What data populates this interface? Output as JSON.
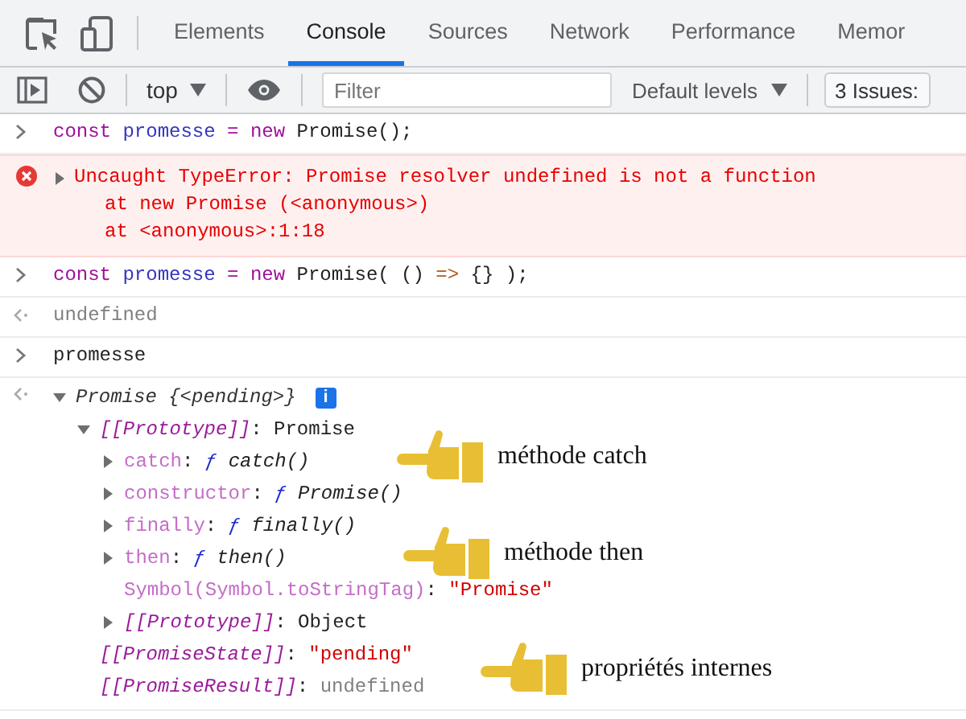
{
  "tabbar": {
    "tabs": [
      {
        "label": "Elements",
        "selected": false
      },
      {
        "label": "Console",
        "selected": true
      },
      {
        "label": "Sources",
        "selected": false
      },
      {
        "label": "Network",
        "selected": false
      },
      {
        "label": "Performance",
        "selected": false
      },
      {
        "label": "Memor",
        "selected": false
      }
    ]
  },
  "toolbar": {
    "context": "top",
    "filter": {
      "placeholder": "Filter"
    },
    "levels": "Default levels",
    "issues": "3 Issues:"
  },
  "entries": [
    {
      "kind": "input",
      "tokens": [
        {
          "text": "const ",
          "kind": "keyword"
        },
        {
          "text": "promesse",
          "kind": "variable"
        },
        {
          "text": " = ",
          "kind": "keyword"
        },
        {
          "text": "new ",
          "kind": "keyword"
        },
        {
          "text": "Promise();",
          "kind": "plain"
        }
      ]
    },
    {
      "kind": "error",
      "expanded": false,
      "message": "Uncaught TypeError: Promise resolver undefined is not a function",
      "stack": [
        "at new Promise (<anonymous>)",
        "at <anonymous>:1:18"
      ]
    },
    {
      "kind": "input",
      "tokens": [
        {
          "text": "const ",
          "kind": "keyword"
        },
        {
          "text": "promesse",
          "kind": "variable"
        },
        {
          "text": " = ",
          "kind": "keyword"
        },
        {
          "text": "new ",
          "kind": "keyword"
        },
        {
          "text": "Promise( () ",
          "kind": "plain"
        },
        {
          "text": "=>",
          "kind": "arrow"
        },
        {
          "text": " {} );",
          "kind": "plain"
        }
      ]
    },
    {
      "kind": "result",
      "tokens": [
        {
          "text": "undefined",
          "kind": "undef"
        }
      ]
    },
    {
      "kind": "input",
      "tokens": [
        {
          "text": "promesse",
          "kind": "plain"
        }
      ]
    },
    {
      "kind": "tree",
      "badge": "i",
      "root": {
        "kind": "node",
        "expanded": true,
        "tokens": [
          {
            "text": "Promise {<pending>}",
            "kind": "preview"
          }
        ],
        "children": [
          {
            "kind": "node",
            "expanded": true,
            "tokens": [
              {
                "text": "[[Prototype]]",
                "kind": "internal"
              },
              {
                "text": ": Promise",
                "kind": "plain"
              }
            ],
            "children": [
              {
                "kind": "node",
                "expanded": false,
                "tokens": [
                  {
                    "text": "catch",
                    "kind": "prop"
                  },
                  {
                    "text": ": ",
                    "kind": "plain"
                  },
                  {
                    "text": "ƒ ",
                    "kind": "fn"
                  },
                  {
                    "text": "catch()",
                    "kind": "fname"
                  }
                ]
              },
              {
                "kind": "node",
                "expanded": false,
                "tokens": [
                  {
                    "text": "constructor",
                    "kind": "prop"
                  },
                  {
                    "text": ": ",
                    "kind": "plain"
                  },
                  {
                    "text": "ƒ ",
                    "kind": "fn"
                  },
                  {
                    "text": "Promise()",
                    "kind": "fname"
                  }
                ]
              },
              {
                "kind": "node",
                "expanded": false,
                "tokens": [
                  {
                    "text": "finally",
                    "kind": "prop"
                  },
                  {
                    "text": ": ",
                    "kind": "plain"
                  },
                  {
                    "text": "ƒ ",
                    "kind": "fn"
                  },
                  {
                    "text": "finally()",
                    "kind": "fname"
                  }
                ]
              },
              {
                "kind": "node",
                "expanded": false,
                "tokens": [
                  {
                    "text": "then",
                    "kind": "prop"
                  },
                  {
                    "text": ": ",
                    "kind": "plain"
                  },
                  {
                    "text": "ƒ ",
                    "kind": "fn"
                  },
                  {
                    "text": "then()",
                    "kind": "fname"
                  }
                ]
              },
              {
                "kind": "leaf",
                "tokens": [
                  {
                    "text": "Symbol(Symbol.toStringTag)",
                    "kind": "prop"
                  },
                  {
                    "text": ": ",
                    "kind": "plain"
                  },
                  {
                    "text": "\"Promise\"",
                    "kind": "string"
                  }
                ]
              },
              {
                "kind": "node",
                "expanded": false,
                "tokens": [
                  {
                    "text": "[[Prototype]]",
                    "kind": "internal"
                  },
                  {
                    "text": ": Object",
                    "kind": "plain"
                  }
                ]
              }
            ]
          },
          {
            "kind": "leaf",
            "tokens": [
              {
                "text": "[[PromiseState]]",
                "kind": "internal"
              },
              {
                "text": ": ",
                "kind": "plain"
              },
              {
                "text": "\"pending\"",
                "kind": "string"
              }
            ]
          },
          {
            "kind": "leaf",
            "tokens": [
              {
                "text": "[[PromiseResult]]",
                "kind": "internal"
              },
              {
                "text": ": ",
                "kind": "plain"
              },
              {
                "text": "undefined",
                "kind": "undef"
              }
            ]
          }
        ]
      }
    }
  ],
  "annotations": [
    {
      "label": "méthode catch"
    },
    {
      "label": "méthode then"
    },
    {
      "label": "propriétés internes"
    }
  ]
}
